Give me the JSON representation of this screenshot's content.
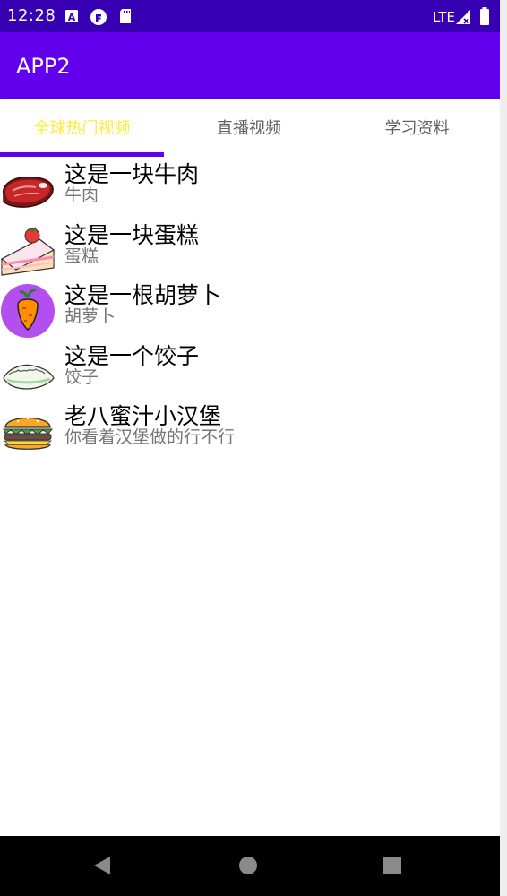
{
  "status_bar": {
    "time": "12:28",
    "network": "LTE",
    "icons": [
      "a-icon",
      "f-icon",
      "sd-card-icon",
      "signal-icon",
      "battery-icon"
    ]
  },
  "app_bar": {
    "title": "APP2"
  },
  "tabs": [
    {
      "label": "全球热门视频",
      "selected": true
    },
    {
      "label": "直播视频",
      "selected": false
    },
    {
      "label": "学习资料",
      "selected": false
    }
  ],
  "colors": {
    "status_bar": "#3700b3",
    "primary": "#6200ee",
    "tab_selected_text": "#ffeb3b",
    "tab_text": "#616161"
  },
  "list": [
    {
      "title": "这是一块牛肉",
      "subtitle": "牛肉",
      "icon": "steak-icon"
    },
    {
      "title": "这是一块蛋糕",
      "subtitle": "蛋糕",
      "icon": "cake-icon"
    },
    {
      "title": "这是一根胡萝卜",
      "subtitle": "胡萝卜",
      "icon": "carrot-icon"
    },
    {
      "title": "这是一个饺子",
      "subtitle": "饺子",
      "icon": "dumpling-icon"
    },
    {
      "title": "老八蜜汁小汉堡",
      "subtitle": "你看着汉堡做的行不行",
      "icon": "burger-icon"
    }
  ],
  "nav_bar": {
    "buttons": [
      "back-icon",
      "home-icon",
      "recents-icon"
    ]
  }
}
